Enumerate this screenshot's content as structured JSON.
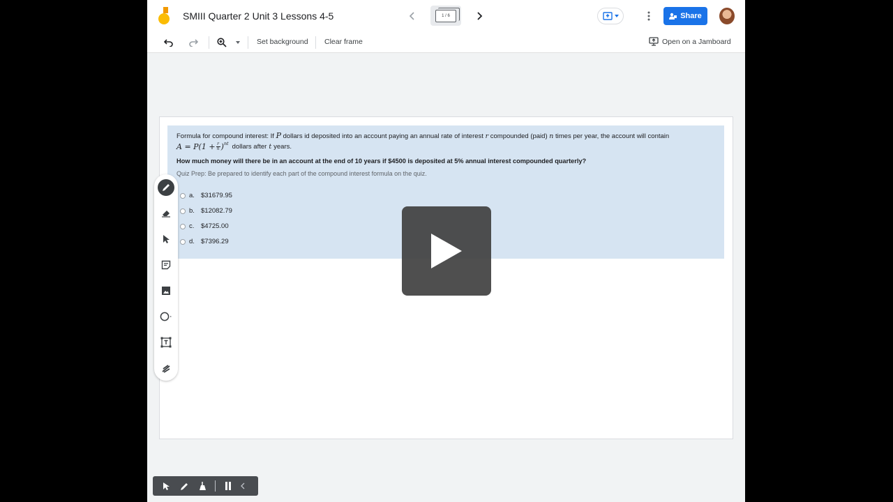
{
  "header": {
    "title": "SMIII Quarter 2 Unit 3 Lessons 4-5",
    "frame_counter": "1 / 6",
    "share_label": "Share"
  },
  "toolbar": {
    "set_background": "Set background",
    "clear_frame": "Clear frame",
    "open_jamboard": "Open on a Jamboard"
  },
  "question": {
    "formula_intro": "Formula for compound interest: If",
    "formula_p": "P",
    "formula_mid": "dollars id deposited into an account paying an annual rate of interest",
    "formula_r": "r",
    "formula_comp": "compounded (paid)",
    "formula_n": "n",
    "formula_end": "times per year, the account will contain",
    "equation_lhs": "A = P(1 +",
    "equation_frac_num": "r",
    "equation_frac_den": "n",
    "equation_rhs": ")",
    "equation_exp": "nt",
    "equation_after": "dollars after",
    "equation_t": "t",
    "equation_years": "years.",
    "prompt": "How much money will there be in an account at the end of 10 years if $4500 is deposited at 5% annual interest compounded quarterly?",
    "quiz_prep": "Quiz Prep: Be prepared to identify each part of the compound interest formula on the quiz.",
    "options": [
      {
        "letter": "a.",
        "value": "$31679.95"
      },
      {
        "letter": "b.",
        "value": "$12082.79"
      },
      {
        "letter": "c.",
        "value": "$4725.00"
      },
      {
        "letter": "d.",
        "value": "$7396.29"
      }
    ]
  },
  "icons": {
    "side_tools": [
      "pen-icon",
      "eraser-icon",
      "select-icon",
      "sticky-note-icon",
      "image-icon",
      "shape-icon",
      "text-box-icon",
      "laser-icon"
    ],
    "bottom": [
      "pointer-icon",
      "pencil-icon",
      "broom-icon",
      "pause-icon",
      "collapse-icon"
    ]
  },
  "colors": {
    "accent": "#1a73e8",
    "question_bg": "#d6e4f2",
    "play_overlay": "#424242"
  }
}
